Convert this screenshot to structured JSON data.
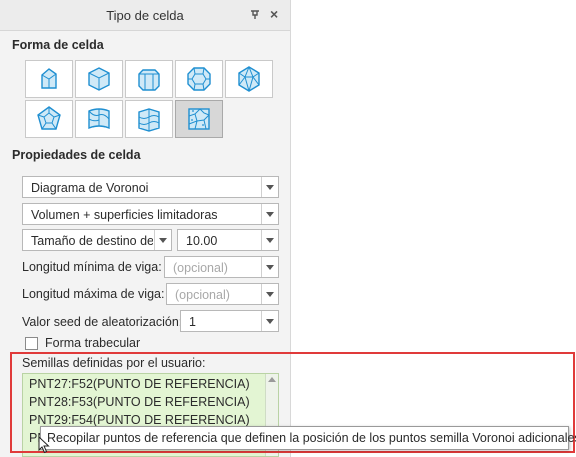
{
  "panel": {
    "title": "Tipo de celda",
    "pin_icon": "pin-icon",
    "close_icon": "×"
  },
  "cell_shape": {
    "heading": "Forma de celda",
    "shapes": [
      {
        "name": "cube-cell-icon"
      },
      {
        "name": "cube-iso-cell-icon"
      },
      {
        "name": "hex-prism-cell-icon"
      },
      {
        "name": "truncated-octahedron-cell-icon"
      },
      {
        "name": "rhombic-dodecahedron-cell-icon"
      },
      {
        "name": "dodecahedron-cell-icon"
      },
      {
        "name": "twisted-cell-icon"
      },
      {
        "name": "bent-prism-cell-icon"
      },
      {
        "name": "voronoi-cell-icon",
        "selected": true
      }
    ]
  },
  "cell_properties": {
    "heading": "Propiedades de celda",
    "type_value": "Diagrama de Voronoi",
    "mode_value": "Volumen + superficies limitadoras",
    "size_type_value": "Tamaño de destino de la",
    "size_value": "10.00",
    "min_beam_label": "Longitud mínima de viga:",
    "min_beam_placeholder": "(opcional)",
    "max_beam_label": "Longitud máxima de viga:",
    "max_beam_placeholder": "(opcional)",
    "seed_label": "Valor seed de aleatorización:",
    "seed_value": "1",
    "trabecular_label": "Forma trabecular",
    "trabecular_checked": false,
    "seeds_label": "Semillas definidas por el usuario:",
    "seeds": [
      "PNT27:F52(PUNTO DE REFERENCIA)",
      "PNT28:F53(PUNTO DE REFERENCIA)",
      "PNT29:F54(PUNTO DE REFERENCIA)",
      "PN"
    ]
  },
  "tooltip": "Recopilar puntos de referencia que definen la posición de los puntos semilla Voronoi adicionales.",
  "colors": {
    "icon_blue": "#1f8fd1",
    "icon_fill": "#cfe9f7",
    "list_bg": "#e3f5d3",
    "highlight_red": "#e03a3a"
  }
}
